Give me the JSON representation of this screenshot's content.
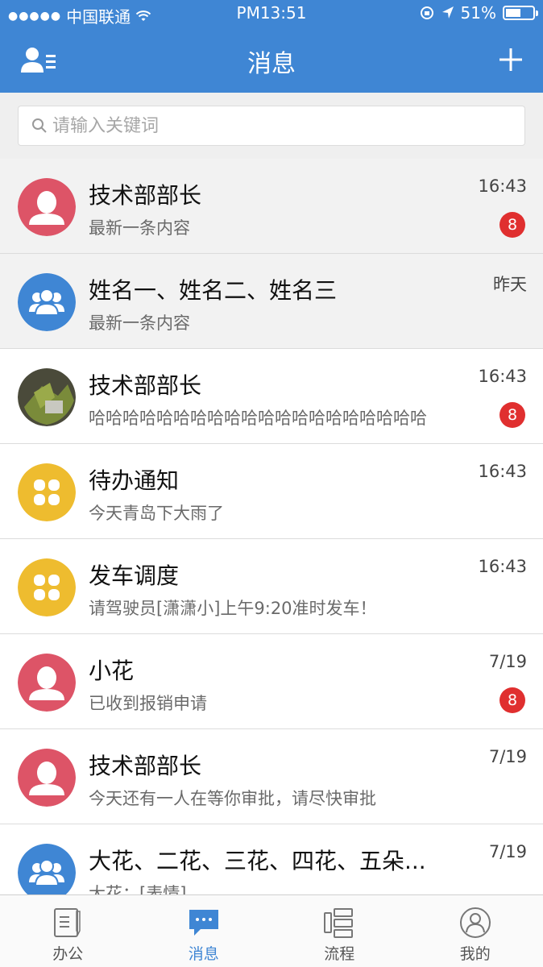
{
  "status_bar": {
    "carrier": "中国联通",
    "time": "PM13:51",
    "battery": "51%",
    "battery_level": 0.51
  },
  "nav": {
    "title": "消息"
  },
  "search": {
    "placeholder": "请输入关键词"
  },
  "messages": [
    {
      "name": "技术部部长",
      "preview": "最新一条内容",
      "time": "16:43",
      "badge": "8",
      "avatar": "female-avatar",
      "highlight": true
    },
    {
      "name": "姓名一、姓名二、姓名三",
      "preview": "最新一条内容",
      "time": "昨天",
      "badge": "",
      "avatar": "group-avatar",
      "highlight": true
    },
    {
      "name": "技术部部长",
      "preview": "哈哈哈哈哈哈哈哈哈哈哈哈哈哈哈哈哈哈哈哈",
      "time": "16:43",
      "badge": "8",
      "avatar": "photo-avatar",
      "highlight": false
    },
    {
      "name": "待办通知",
      "preview": "今天青岛下大雨了",
      "time": "16:43",
      "badge": "",
      "avatar": "clover-avatar",
      "highlight": false
    },
    {
      "name": "发车调度",
      "preview": "请驾驶员[潇潇小]上午9:20准时发车！",
      "time": "16:43",
      "badge": "",
      "avatar": "clover-avatar",
      "highlight": false
    },
    {
      "name": "小花",
      "preview": "已收到报销申请",
      "time": "7/19",
      "badge": "8",
      "avatar": "female-avatar",
      "highlight": false
    },
    {
      "name": "技术部部长",
      "preview": "今天还有一人在等你审批，请尽快审批",
      "time": "7/19",
      "badge": "",
      "avatar": "female-avatar",
      "highlight": false
    },
    {
      "name": "大花、二花、三花、四花、五朵...",
      "preview": "大花：[表情]",
      "time": "7/19",
      "badge": "",
      "avatar": "group-avatar",
      "highlight": false
    }
  ],
  "tabs": [
    {
      "label": "办公",
      "icon": "office-icon"
    },
    {
      "label": "消息",
      "icon": "message-icon",
      "active": true
    },
    {
      "label": "流程",
      "icon": "flow-icon"
    },
    {
      "label": "我的",
      "icon": "profile-icon"
    }
  ],
  "colors": {
    "primary": "#3f86d4",
    "badge": "#e02f2f",
    "female": "#dd5467",
    "group": "#3f86d4",
    "clover": "#eebc2f"
  }
}
